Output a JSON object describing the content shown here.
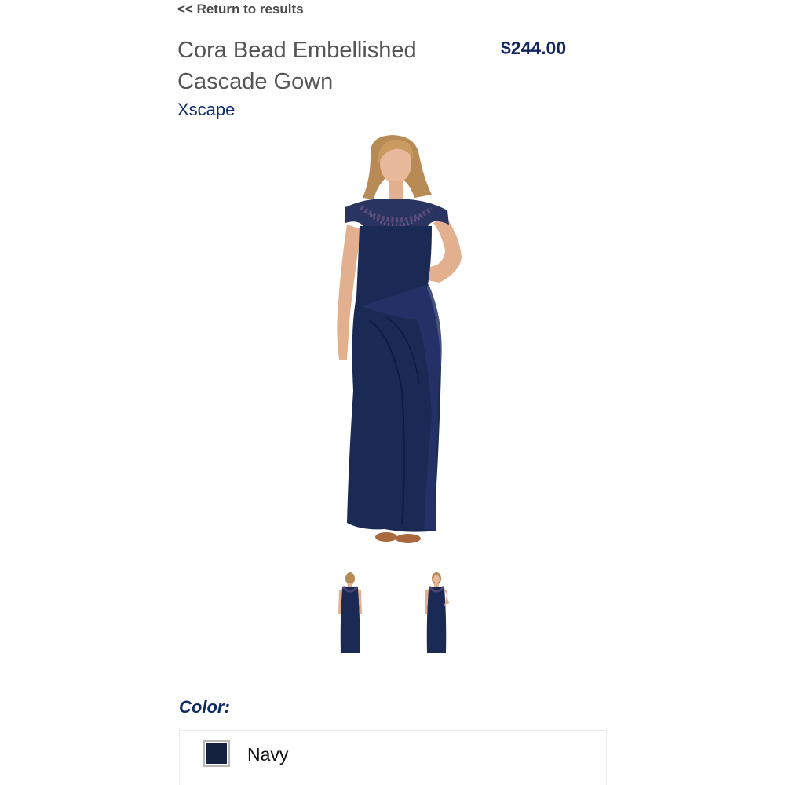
{
  "nav": {
    "return_label": "<< Return to results"
  },
  "product": {
    "title": "Cora Bead Embellished Cascade Gown",
    "price": "$244.00",
    "brand": "Xscape"
  },
  "images": {
    "main": {
      "icon": "model-in-navy-gown-image"
    },
    "thumbnails": [
      {
        "icon": "gown-back-view-thumbnail"
      },
      {
        "icon": "gown-front-view-thumbnail"
      }
    ]
  },
  "color": {
    "label": "Color:",
    "selected_name": "Navy",
    "selected_hex": "#14213f"
  },
  "theme": {
    "accent": "#13245f",
    "link": "#0e2e6e",
    "dress": "#1b2a55"
  }
}
